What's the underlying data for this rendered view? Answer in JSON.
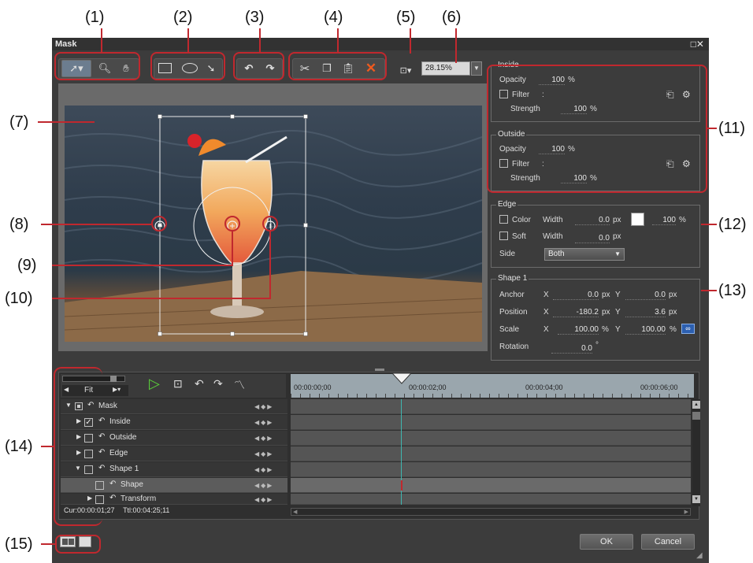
{
  "window": {
    "title": "Mask",
    "controls": "□✕"
  },
  "callouts": [
    "(1)",
    "(2)",
    "(3)",
    "(4)",
    "(5)",
    "(6)",
    "(7)",
    "(8)",
    "(9)",
    "(10)",
    "(11)",
    "(12)",
    "(13)",
    "(14)",
    "(15)"
  ],
  "toolbar": {
    "zoom_value": "28.15%",
    "icons": [
      "select-arrow-icon",
      "zoom-icon",
      "hand-icon",
      "rectangle-icon",
      "ellipse-icon",
      "pen-icon",
      "undo-icon",
      "redo-icon",
      "cut-icon",
      "copy-icon",
      "paste-icon",
      "delete-icon",
      "view-fit-icon"
    ]
  },
  "inside": {
    "title": "Inside",
    "opacity_label": "Opacity",
    "opacity_value": "100",
    "opacity_unit": "%",
    "filter_label": "Filter",
    "filter_colon": ":",
    "strength_label": "Strength",
    "strength_value": "100",
    "strength_unit": "%"
  },
  "outside": {
    "title": "Outside",
    "opacity_label": "Opacity",
    "opacity_value": "100",
    "opacity_unit": "%",
    "filter_label": "Filter",
    "filter_colon": ":",
    "strength_label": "Strength",
    "strength_value": "100",
    "strength_unit": "%"
  },
  "edge": {
    "title": "Edge",
    "color_label": "Color",
    "width_label": "Width",
    "color_width": "0.0",
    "px": "px",
    "color_pct": "100",
    "pct": "%",
    "soft_label": "Soft",
    "soft_width": "0.0",
    "side_label": "Side",
    "side_value": "Both",
    "swatch_color": "#ffffff"
  },
  "shape1": {
    "title": "Shape 1",
    "anchor_label": "Anchor",
    "anchor_x": "0.0",
    "anchor_y": "0.0",
    "position_label": "Position",
    "position_x": "-180.2",
    "position_y": "3.6",
    "scale_label": "Scale",
    "scale_x": "100.00",
    "scale_y": "100.00",
    "rotation_label": "Rotation",
    "rotation_value": "0.0",
    "deg": "°",
    "x": "X",
    "y": "Y",
    "px": "px",
    "pct": "%"
  },
  "timeline": {
    "fit_label": "Fit",
    "ruler": [
      "00:00:00;00",
      "00:00:02;00",
      "00:00:04;00",
      "00:00:06;00"
    ],
    "rows": [
      {
        "label": "Mask"
      },
      {
        "label": "Inside"
      },
      {
        "label": "Outside"
      },
      {
        "label": "Edge"
      },
      {
        "label": "Shape 1"
      },
      {
        "label": "Shape"
      },
      {
        "label": "Transform"
      }
    ],
    "cur_label": "Cur:00:00:01;27",
    "ttl_label": "Ttl:00:04:25;11",
    "playhead_color": "#3fb6b0"
  },
  "buttons": {
    "ok": "OK",
    "cancel": "Cancel"
  },
  "colors": {
    "highlight": "#c0282e",
    "window_bg": "#3c3c3c",
    "play": "#5bd23a",
    "delete": "#f05a1e"
  }
}
